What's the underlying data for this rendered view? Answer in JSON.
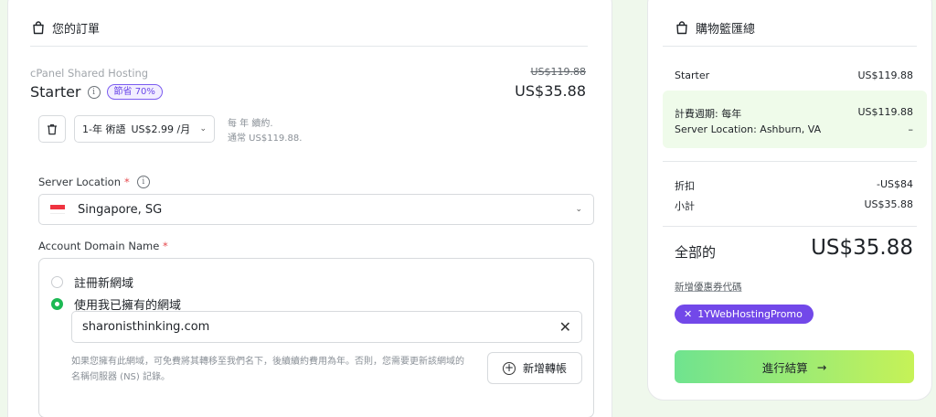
{
  "order": {
    "heading": "您的訂單",
    "product_category": "cPanel Shared Hosting",
    "product_name": "Starter",
    "info_glyph": "i",
    "save_badge": "節省 70%",
    "original_price": "US$119.88",
    "price": "US$35.88",
    "term_select": {
      "term": "1-年 術語",
      "per_month": "US$2.99 /月"
    },
    "renew_note_line1": "每 年 續約.",
    "renew_note_line2": "通常 US$119.88.",
    "server_location": {
      "label": "Server Location",
      "required_mark": "*",
      "value": "Singapore, SG"
    },
    "account_domain": {
      "label": "Account Domain Name",
      "required_mark": "*",
      "option_register": "註冊新網域",
      "option_existing": "使用我已擁有的網域",
      "selected_option": "existing",
      "domain_value": "sharonisthinking.com",
      "clear_glyph": "✕",
      "help_text": "如果您擁有此網域，可免費將其轉移至我們名下，後續續約費用為年。否則，您需要更新該網域的名稱伺服器 (NS) 記錄。",
      "add_transfer_label": "新增轉帳",
      "plus_glyph": "+"
    }
  },
  "cart": {
    "heading": "購物籃匯總",
    "rows": {
      "starter_label": "Starter",
      "starter_value": "US$119.88",
      "billing_label": "計費週期: 每年",
      "billing_value": "US$119.88",
      "server_label": "Server Location: Ashburn, VA",
      "server_value": "–",
      "discount_label": "折扣",
      "discount_value": "-US$84",
      "subtotal_label": "小計",
      "subtotal_value": "US$35.88"
    },
    "total_label": "全部的",
    "total_value": "US$35.88",
    "coupon_link": "新增優惠券代碼",
    "promo_code": "1YWebHostingPromo",
    "promo_remove_glyph": "✕",
    "checkout_label": "進行結算",
    "checkout_arrow": "→"
  },
  "icons": {
    "bag": "shopping-bag-icon",
    "trash": "trash-icon",
    "info": "info-icon",
    "chevron": "chevron-down-icon",
    "flag": "singapore-flag-icon",
    "clear": "close-icon",
    "plus": "plus-circle-icon",
    "arrow": "arrow-right-icon"
  },
  "colors": {
    "accent_purple": "#7248e9",
    "radio_green": "#1db954",
    "checkout_gradient_start": "#6fe38f",
    "checkout_gradient_end": "#c6f257",
    "page_background": "#eff8ec"
  }
}
